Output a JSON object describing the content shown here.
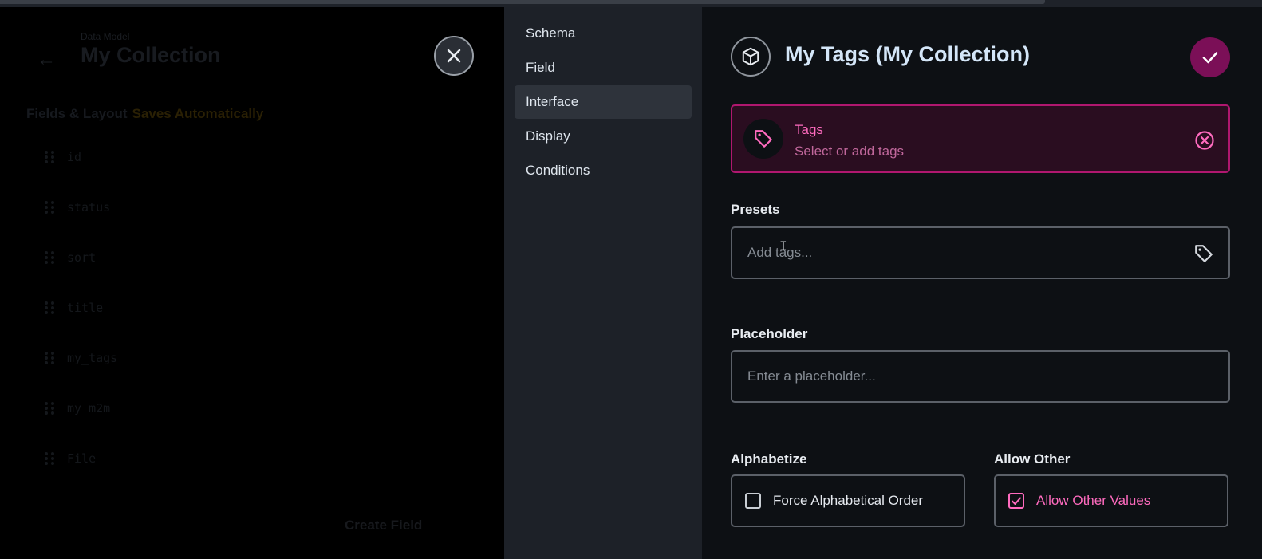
{
  "background": {
    "breadcrumb": "Data Model",
    "title": "My Collection",
    "section_title": "Fields & Layout",
    "section_note": "Saves Automatically",
    "fields": [
      "id",
      "status",
      "sort",
      "title",
      "my_tags",
      "my_m2m",
      "File"
    ],
    "create_field_label": "Create Field"
  },
  "nav": {
    "items": [
      {
        "label": "Schema",
        "active": false
      },
      {
        "label": "Field",
        "active": false
      },
      {
        "label": "Interface",
        "active": true
      },
      {
        "label": "Display",
        "active": false
      },
      {
        "label": "Conditions",
        "active": false
      }
    ]
  },
  "header": {
    "title": "My Tags (My Collection)",
    "icon": "box-icon",
    "save_icon": "check-icon",
    "close_icon": "close-icon"
  },
  "selected_interface": {
    "name": "Tags",
    "description": "Select or add tags",
    "icon": "tag-icon",
    "remove_icon": "close-circle-icon"
  },
  "presets": {
    "label": "Presets",
    "placeholder": "Add tags...",
    "icon": "tag-icon"
  },
  "placeholder_field": {
    "label": "Placeholder",
    "placeholder": "Enter a placeholder..."
  },
  "alphabetize": {
    "label": "Alphabetize",
    "option_label": "Force Alphabetical Order",
    "checked": false
  },
  "allow_other": {
    "label": "Allow Other",
    "option_label": "Allow Other Values",
    "checked": true
  },
  "colors": {
    "accent": "#ff6bbf",
    "accent_dark": "#7b0f57",
    "panel": "#0d1014",
    "nav_bg": "#1d2128"
  }
}
